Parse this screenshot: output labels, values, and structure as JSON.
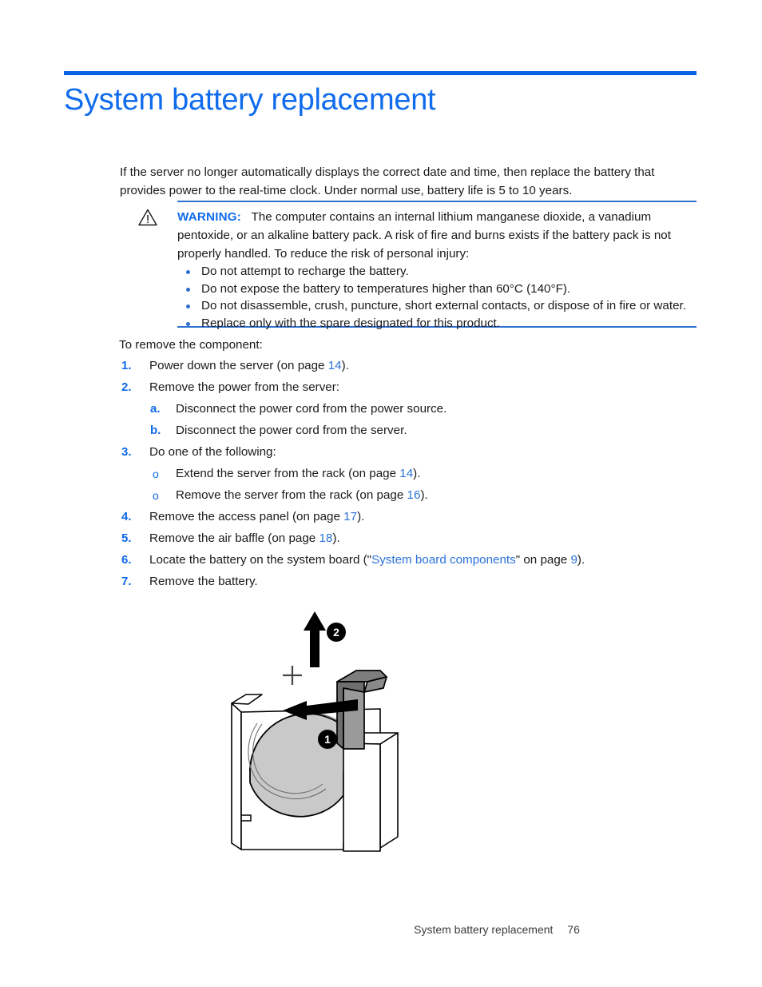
{
  "document": {
    "title": "System battery replacement",
    "accent_color": "#106ced",
    "rule_color": "#0b62e4",
    "link_color": "#2b72d8",
    "intro": "If the server no longer automatically displays the correct date and time, then replace the battery that provides power to the real-time clock. Under normal use, battery life is 5 to 10 years."
  },
  "warning": {
    "icon": "warning-triangle-icon",
    "label": "WARNING:",
    "text": "The computer contains an internal lithium manganese dioxide, a vanadium pentoxide, or an alkaline battery pack. A risk of fire and burns exists if the battery pack is not properly handled. To reduce the risk of personal injury:",
    "bullets": [
      "Do not attempt to recharge the battery.",
      "Do not expose the battery to temperatures higher than 60°C (140°F).",
      "Do not disassemble, crush, puncture, short external contacts, or dispose of in fire or water.",
      "Replace only with the spare designated for this product."
    ]
  },
  "procedure": {
    "lead": "To remove the component:",
    "steps": [
      {
        "marker": "1.",
        "level": 1,
        "parts": [
          {
            "t": "Power down the server (on page "
          },
          {
            "t": "14",
            "link": true
          },
          {
            "t": ")."
          }
        ]
      },
      {
        "marker": "2.",
        "level": 1,
        "parts": [
          {
            "t": "Remove the power from the server:"
          }
        ]
      },
      {
        "marker": "a.",
        "level": 2,
        "parts": [
          {
            "t": "Disconnect the power cord from the power source."
          }
        ]
      },
      {
        "marker": "b.",
        "level": 2,
        "parts": [
          {
            "t": "Disconnect the power cord from the server."
          }
        ]
      },
      {
        "marker": "3.",
        "level": 1,
        "parts": [
          {
            "t": "Do one of the following:"
          }
        ]
      },
      {
        "marker": "o",
        "level": 3,
        "parts": [
          {
            "t": "Extend the server from the rack (on page "
          },
          {
            "t": "14",
            "link": true
          },
          {
            "t": ")."
          }
        ]
      },
      {
        "marker": "o",
        "level": 3,
        "parts": [
          {
            "t": "Remove the server from the rack (on page "
          },
          {
            "t": "16",
            "link": true
          },
          {
            "t": ")."
          }
        ]
      },
      {
        "marker": "4.",
        "level": 1,
        "parts": [
          {
            "t": "Remove the access panel (on page "
          },
          {
            "t": "17",
            "link": true
          },
          {
            "t": ")."
          }
        ]
      },
      {
        "marker": "5.",
        "level": 1,
        "parts": [
          {
            "t": "Remove the air baffle (on page "
          },
          {
            "t": "18",
            "link": true
          },
          {
            "t": ")."
          }
        ]
      },
      {
        "marker": "6.",
        "level": 1,
        "parts": [
          {
            "t": "Locate the battery on the system board (\""
          },
          {
            "t": "System board components",
            "link": true
          },
          {
            "t": "\" on page "
          },
          {
            "t": "9",
            "link": true
          },
          {
            "t": ")."
          }
        ]
      },
      {
        "marker": "7.",
        "level": 1,
        "parts": [
          {
            "t": "Remove the battery."
          }
        ]
      }
    ]
  },
  "figure": {
    "name": "system-battery-removal-diagram",
    "description": "Coin cell battery being released from its socket on the system board",
    "callouts": [
      {
        "id": "1",
        "action": "slide-latch-arrow"
      },
      {
        "id": "2",
        "action": "lift-battery-arrow"
      }
    ],
    "battery_polarity_mark": "+"
  },
  "footer": {
    "title": "System battery replacement",
    "page_number": "76"
  }
}
